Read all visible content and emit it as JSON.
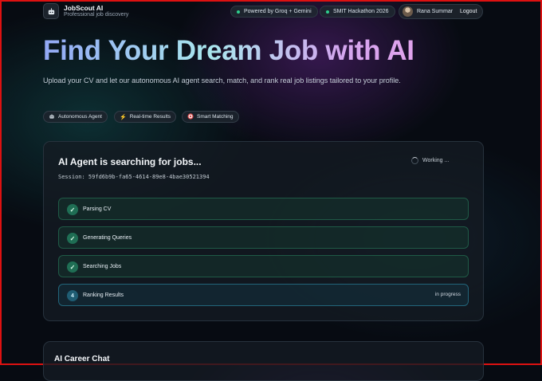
{
  "header": {
    "brand": "JobScout AI",
    "tagline": "Professional job discovery",
    "powered_by": "Powered by Groq + Gemini",
    "event": "SMIT Hackathon 2026",
    "user_name": "Rana Summar",
    "logout_label": "Logout"
  },
  "hero": {
    "title": "Find Your Dream Job with AI",
    "subtitle": "Upload your CV and let our autonomous AI agent search, match, and rank real job listings tailored to your profile.",
    "tags": [
      {
        "icon": "robot-icon",
        "label": "Autonomous Agent"
      },
      {
        "icon": "lightning-icon",
        "label": "Real-time Results"
      },
      {
        "icon": "target-icon",
        "label": "Smart Matching"
      }
    ]
  },
  "agent": {
    "title": "AI Agent is searching for jobs...",
    "session": "Session: 59fd6b9b-fa65-4614-89e8-4bae30521394",
    "status": "Working ...",
    "steps": [
      {
        "label": "Parsing CV",
        "state": "done",
        "marker": "✓"
      },
      {
        "label": "Generating Queries",
        "state": "done",
        "marker": "✓"
      },
      {
        "label": "Searching Jobs",
        "state": "done",
        "marker": "✓"
      },
      {
        "label": "Ranking Results",
        "state": "in progress",
        "marker": "4",
        "status_text": "in progress"
      }
    ]
  },
  "chat": {
    "title": "AI Career Chat"
  },
  "colors": {
    "background": "#070b12",
    "done_accent": "#1f6e54",
    "active_accent": "#1f5d73",
    "status_dot": "#2ecf8d"
  }
}
